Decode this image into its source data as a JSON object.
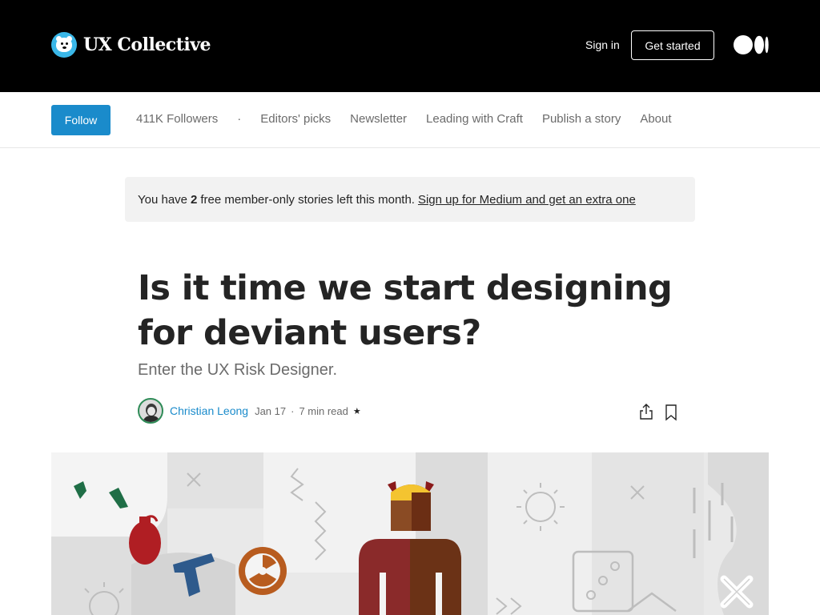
{
  "header": {
    "brand_name": "UX Collective",
    "sign_in": "Sign in",
    "get_started": "Get started"
  },
  "nav": {
    "follow": "Follow",
    "followers": "411K Followers",
    "separator": "·",
    "items": [
      "Editors' picks",
      "Newsletter",
      "Leading with Craft",
      "Publish a story",
      "About"
    ]
  },
  "banner": {
    "prefix": "You have",
    "count": "2",
    "suffix": "free member-only stories left this month.",
    "link": "Sign up for Medium and get an extra one"
  },
  "article": {
    "title": "Is it time we start designing for deviant users?",
    "subtitle": "Enter the UX Risk Designer.",
    "author": "Christian Leong",
    "date": "Jan 17",
    "read_time": "7 min read",
    "separator": "·",
    "member_icon": "star-icon"
  },
  "colors": {
    "accent": "#1a8bcb",
    "header_bg": "#000000",
    "banner_bg": "#f2f2f2",
    "hero_bg": "#e9e9e9"
  }
}
